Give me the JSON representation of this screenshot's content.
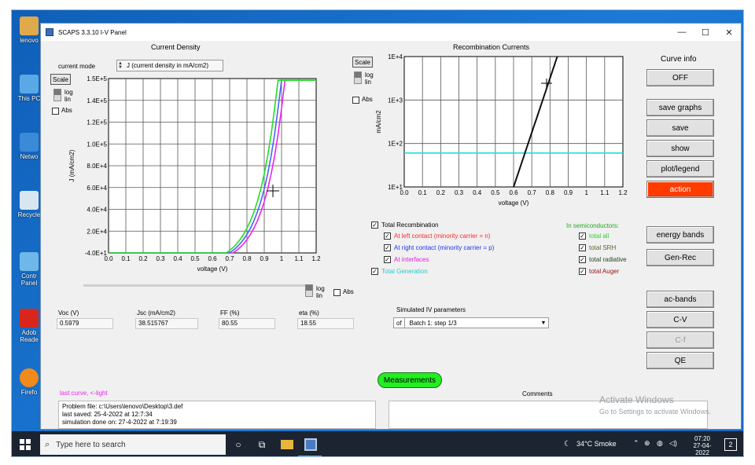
{
  "window": {
    "title": "SCAPS 3.3.10 I-V Panel"
  },
  "desktop_icons": [
    {
      "label": "lenovo",
      "color": "#e0a94c"
    },
    {
      "label": "This PC",
      "color": "#5aa9e6"
    },
    {
      "label": "Netwo",
      "color": "#3a8ad8"
    },
    {
      "label": "Recycle",
      "color": "#d8e6f2"
    },
    {
      "label": "Contr Panel",
      "color": "#6fb7e8"
    },
    {
      "label": "Adob Reade",
      "color": "#d9261c"
    },
    {
      "label": "Firefo",
      "color": "#f08a1c"
    }
  ],
  "current_density": {
    "title": "Current Density",
    "current_mode_label": "current mode",
    "current_mode_value": "J (current density in mA/cm2)",
    "scale_label": "Scale",
    "log_label": "log",
    "lin_label": "lin",
    "abs_label": "Abs",
    "bottom_log": "log",
    "bottom_lin": "lin",
    "bottom_abs": "Abs",
    "ylabel": "J (mA/cm2)",
    "xlabel": "voltage (V)",
    "yticks": [
      "1.5E+5",
      "1.4E+5",
      "1.2E+5",
      "1.0E+5",
      "8.0E+4",
      "6.0E+4",
      "4.0E+4",
      "2.0E+4",
      "-4.0E+1"
    ],
    "xticks": [
      "0.0",
      "0.1",
      "0.2",
      "0.3",
      "0.4",
      "0.5",
      "0.6",
      "0.7",
      "0.8",
      "0.9",
      "1",
      "1.1",
      "1.2"
    ]
  },
  "recombination": {
    "title": "Recombination Currents",
    "scale_label": "Scale",
    "log_label": "log",
    "lin_label": "lin",
    "abs_label": "Abs",
    "ylabel": "mA/cm2",
    "xlabel": "voltage (V)",
    "yticks": [
      "1E+4",
      "1E+3",
      "1E+2",
      "1E+1"
    ],
    "xticks": [
      "0.0",
      "0.1",
      "0.2",
      "0.3",
      "0.4",
      "0.5",
      "0.6",
      "0.7",
      "0.8",
      "0.9",
      "1",
      "1.1",
      "1.2"
    ]
  },
  "recomb_options": {
    "total": "Total Recombination",
    "left": "At left contact (minority carrier = n)",
    "right": "At right contact (minority carrier = p)",
    "interfaces": "At interfaces",
    "generation": "Total Generation",
    "semis_title": "In semiconductors:",
    "all": "total all",
    "srh": "total SRH",
    "radiative": "total radiative",
    "auger": "total Auger"
  },
  "results": {
    "voc_label": "Voc (V)",
    "voc": "0.5979",
    "jsc_label": "Jsc (mA/cm2)",
    "jsc": "38.515767",
    "ff_label": "FF  (%)",
    "ff": "80.55",
    "eta_label": "eta (%)",
    "eta": "18.55"
  },
  "simulated": {
    "title": "Simulated IV parameters",
    "of": "of",
    "batch": "Batch 1: step 1/3"
  },
  "buttons": {
    "curve_info": "Curve info",
    "off": "OFF",
    "save_graphs": "save graphs",
    "save": "save",
    "show": "show",
    "plot_legend": "plot/legend",
    "action": "action",
    "energy_bands": "energy bands",
    "gen_rec": "Gen-Rec",
    "ac_bands": "ac-bands",
    "cv": "C-V",
    "cf": "C-f",
    "qe": "QE",
    "measurements": "Measurements"
  },
  "status": {
    "last_curve": "last curve, <-light",
    "problem_file": "Problem file: c:\\Users\\lenovo\\Desktop\\3.def",
    "last_saved": "last saved: 25-4-2022 at 12:7:34",
    "simulation_done": "simulation done on: 27-4-2022 at 7:19:39",
    "comments": "Comments"
  },
  "watermark": {
    "line1": "Activate Windows",
    "line2": "Go to Settings to activate Windows."
  },
  "taskbar": {
    "search_placeholder": "Type here to search",
    "weather": "34°C  Smoke",
    "time": "07:20",
    "date": "27-04-2022",
    "notifications": "2"
  },
  "colors": {
    "green": "#22dd22",
    "blue": "#4466ff",
    "magenta": "#ee22ee",
    "cyan": "#22dddd",
    "black_curve": "#111111",
    "action_red": "#ff3b00"
  }
}
